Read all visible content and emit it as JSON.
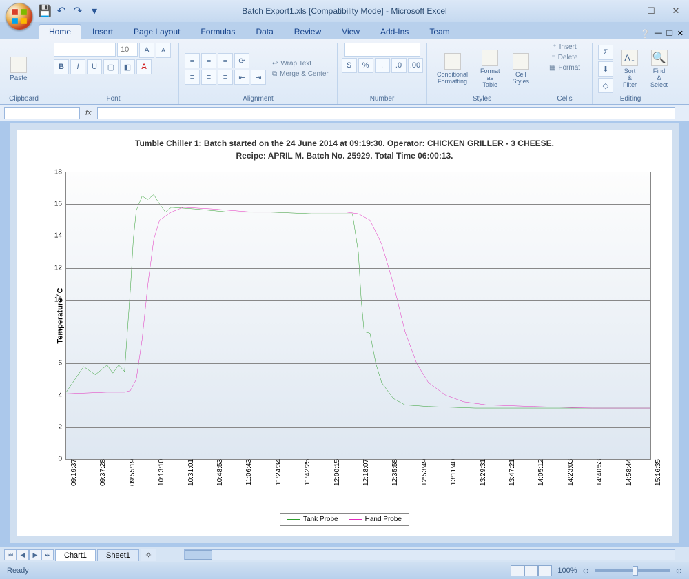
{
  "window": {
    "title": "Batch Export1.xls  [Compatibility Mode] - Microsoft Excel"
  },
  "tabs": [
    "Home",
    "Insert",
    "Page Layout",
    "Formulas",
    "Data",
    "Review",
    "View",
    "Add-Ins",
    "Team"
  ],
  "ribbon": {
    "clipboard": {
      "paste": "Paste",
      "label": "Clipboard"
    },
    "font": {
      "label": "Font",
      "size": "10"
    },
    "alignment": {
      "label": "Alignment",
      "wrap": "Wrap Text",
      "merge": "Merge & Center"
    },
    "number": {
      "label": "Number"
    },
    "styles": {
      "label": "Styles",
      "cond": "Conditional Formatting",
      "fmt": "Format as Table",
      "cell": "Cell Styles"
    },
    "cells": {
      "label": "Cells",
      "insert": "Insert",
      "delete": "Delete",
      "format": "Format"
    },
    "editing": {
      "label": "Editing",
      "sort": "Sort & Filter",
      "find": "Find & Select"
    }
  },
  "status": {
    "ready": "Ready",
    "zoom": "100%"
  },
  "sheets": {
    "active": "Chart1",
    "other": "Sheet1"
  },
  "chart_data": {
    "type": "line",
    "title_line1": "Tumble Chiller 1:   Batch started on the 24 June 2014 at 09:19:30.   Operator: CHICKEN GRILLER - 3 CHEESE.",
    "title_line2": "Recipe: APRIL M.  Batch No. 25929.  Total Time 06:00:13.",
    "ylabel": "Temperature °C",
    "ylim": [
      0,
      18
    ],
    "yticks": [
      0,
      2,
      4,
      6,
      8,
      10,
      12,
      14,
      16,
      18
    ],
    "x_categories": [
      "09:19:37",
      "09:37:28",
      "09:55:19",
      "10:13:10",
      "10:31:01",
      "10:48:53",
      "11:06:43",
      "11:24:34",
      "11:42:25",
      "12:00:15",
      "12:18:07",
      "12:35:58",
      "12:53:49",
      "13:11:40",
      "13:29:31",
      "13:47:21",
      "14:05:12",
      "14:23:03",
      "14:40:53",
      "14:58:44",
      "15:16:35"
    ],
    "series": [
      {
        "name": "Tank Probe",
        "color": "#2e9e2e",
        "points": [
          [
            0,
            4.2
          ],
          [
            3,
            5.8
          ],
          [
            5,
            5.3
          ],
          [
            7,
            5.9
          ],
          [
            8,
            5.4
          ],
          [
            9,
            5.9
          ],
          [
            10,
            5.5
          ],
          [
            11,
            10.7
          ],
          [
            11.5,
            13.8
          ],
          [
            12,
            15.6
          ],
          [
            13,
            16.5
          ],
          [
            14,
            16.3
          ],
          [
            15,
            16.6
          ],
          [
            16,
            16.0
          ],
          [
            17,
            15.5
          ],
          [
            18,
            15.8
          ],
          [
            22,
            15.7
          ],
          [
            28,
            15.5
          ],
          [
            35,
            15.5
          ],
          [
            42,
            15.4
          ],
          [
            48,
            15.4
          ],
          [
            49,
            15.4
          ],
          [
            50,
            13.0
          ],
          [
            50.5,
            10.0
          ],
          [
            51,
            8.0
          ],
          [
            52,
            7.9
          ],
          [
            53,
            6.0
          ],
          [
            54,
            4.8
          ],
          [
            56,
            3.8
          ],
          [
            58,
            3.4
          ],
          [
            62,
            3.3
          ],
          [
            70,
            3.2
          ],
          [
            80,
            3.2
          ],
          [
            90,
            3.2
          ],
          [
            100,
            3.2
          ]
        ]
      },
      {
        "name": "Hand Probe",
        "color": "#e22bbd",
        "points": [
          [
            0,
            4.1
          ],
          [
            7,
            4.2
          ],
          [
            10,
            4.2
          ],
          [
            11,
            4.3
          ],
          [
            12,
            5.0
          ],
          [
            13,
            7.5
          ],
          [
            14,
            11.0
          ],
          [
            15,
            13.8
          ],
          [
            16,
            15.0
          ],
          [
            18,
            15.5
          ],
          [
            20,
            15.8
          ],
          [
            25,
            15.7
          ],
          [
            32,
            15.5
          ],
          [
            40,
            15.5
          ],
          [
            48,
            15.5
          ],
          [
            50,
            15.4
          ],
          [
            52,
            15.0
          ],
          [
            54,
            13.5
          ],
          [
            56,
            11.0
          ],
          [
            58,
            8.0
          ],
          [
            60,
            6.0
          ],
          [
            62,
            4.8
          ],
          [
            65,
            4.0
          ],
          [
            68,
            3.6
          ],
          [
            72,
            3.4
          ],
          [
            80,
            3.3
          ],
          [
            90,
            3.2
          ],
          [
            100,
            3.2
          ]
        ]
      }
    ],
    "legend": [
      "Tank Probe",
      "Hand Probe"
    ]
  }
}
